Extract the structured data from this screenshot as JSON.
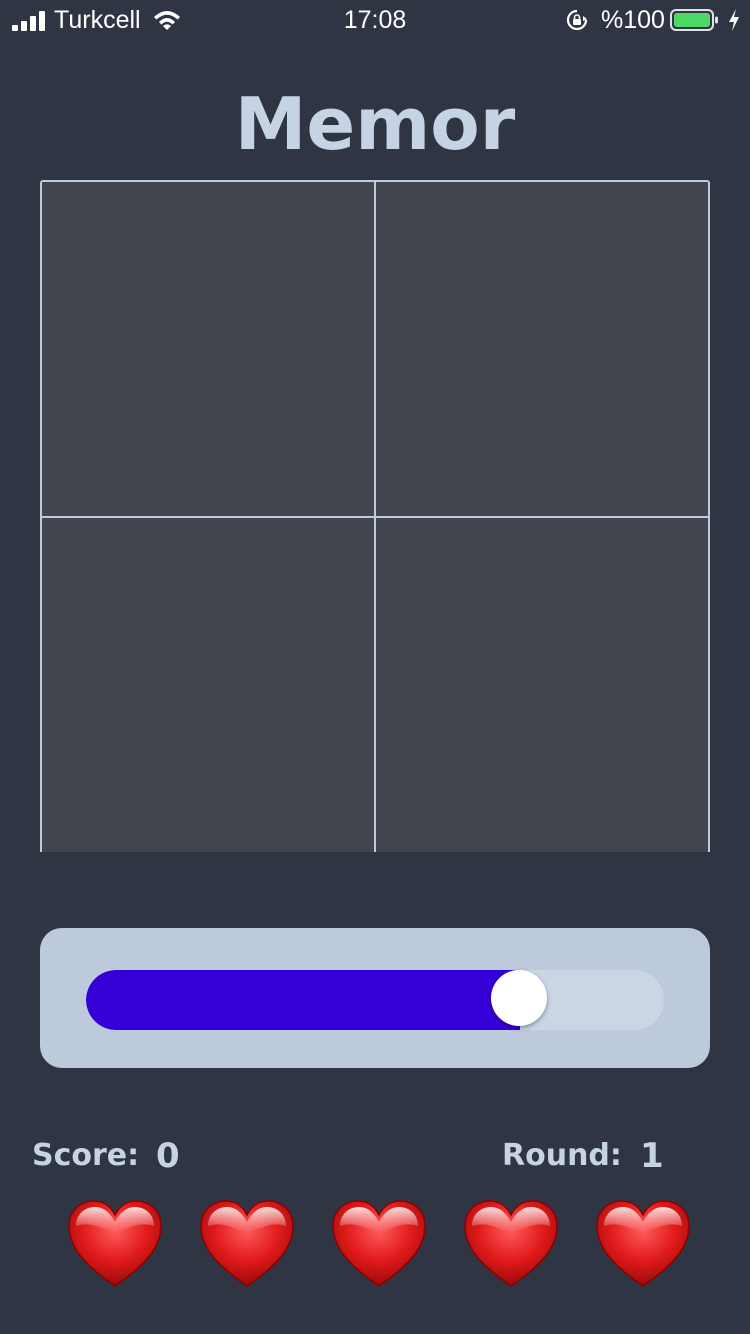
{
  "status_bar": {
    "carrier": "Turkcell",
    "time": "17:08",
    "battery_percent": "%100",
    "icons": [
      "signal-icon",
      "wifi-icon",
      "rotation-lock-icon",
      "battery-icon",
      "charging-bolt-icon"
    ]
  },
  "app": {
    "title": "Memor"
  },
  "grid": {
    "rows": 2,
    "columns": 2,
    "tile_color": "#42454d",
    "line_color": "#bccde0"
  },
  "slider": {
    "value_fraction": 0.75,
    "fill_color": "#3500d8",
    "track_color": "#cad6e6",
    "panel_color": "#bdcadb"
  },
  "stats": {
    "score_label": "Score:",
    "score_value": "0",
    "round_label": "Round:",
    "round_value": "1"
  },
  "lives": {
    "count": 5,
    "icon": "heart-icon",
    "color": "#e01a1a"
  },
  "colors": {
    "background": "#303543",
    "text": "#c5d3e4",
    "battery_fill": "#4cd964"
  }
}
